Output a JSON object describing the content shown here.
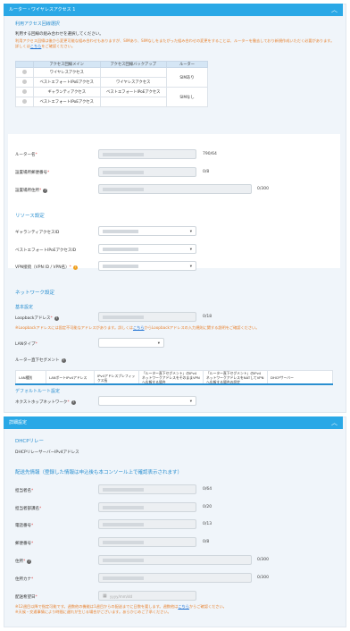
{
  "router_section": {
    "header": "ルーター・ワイヤレスアクセス 1",
    "plan": {
      "title": "利用アクセス回線選択",
      "instruction": "利用する回線の組み合わせを選択してください。",
      "note_before": "利用アクセス回線は後から変更可能な組み合わせもありますが、SIMあり、SIMなしをまたがった組み合わせの変更をすることは、ルーターを撤去しており新規作成いただく必要があります。詳しくは",
      "note_link": "こちら",
      "note_after": "をご確認ください。",
      "columns": [
        "アクセス回線メイン",
        "アクセス回線バックアップ",
        "ルーター"
      ],
      "rows": [
        {
          "main": "ワイヤレスアクセス",
          "backup": ""
        },
        {
          "main": "ベストエフォートIPoEアクセス",
          "backup": "ワイヤレスアクセス"
        },
        {
          "main": "ギャランティアクセス",
          "backup": "ベストエフォートIPoEアクセス"
        },
        {
          "main": "ベストエフォートIPoEアクセス",
          "backup": ""
        }
      ],
      "router_groups": [
        "SIMあり",
        "SIMなし"
      ]
    },
    "fields": {
      "router_name": {
        "label": "ルーター名",
        "count": "790/64"
      },
      "postal_code": {
        "label": "設置場所郵便番号",
        "count": "0/8"
      },
      "address": {
        "label": "設置場所住所",
        "count": "0/300"
      }
    },
    "resources": {
      "title": "リソース設定",
      "guarantee_id": "ギャランティアクセスID",
      "besteffort_id": "ベストエフォートIPoEアクセスID",
      "vpn": "VPN接続（VPN ID / VPN名）"
    },
    "network": {
      "title": "ネットワーク設定",
      "basic": "基本設定",
      "loopback_label": "Loopbackアドレス",
      "loopback_count": "0/18",
      "loopback_note_before": "※Loopbackアドレスには固定不可能なアドレスがあります。詳しくは",
      "loopback_note_link": "こちら",
      "loopback_note_after": "からLoopbackアドレスの入力規則に関する説明をご確認ください。",
      "lan_type": "LANタイプ",
      "lan_segment": "ルーター直下セグメント",
      "segment_columns": [
        "LAN種別",
        "LANポートIPv4アドレス",
        "IPv4アドレスプレフィックス長",
        "「ルーター直下セグメント」のIPv4ネットワークアドレスをそのままVPNへ広報する場合",
        "「ルーター直下セグメント」のIPv4ネットワークアドレスをNATしてVPNへ広報する場合の設定",
        "DHCPサーバー"
      ],
      "default_route": "デフォルトルート設定",
      "next_hop": "ネクストホップネットワーク"
    }
  },
  "detail_section": {
    "header": "詳細設定",
    "dhcp_title": "DHCPリレー",
    "dhcp_item": "DHCPリレーサーバーIPv4アドレス",
    "shipping_title": "配送先情報（登録した情報は申込後も本コンソール上で確認表示されます）",
    "fields": {
      "person": {
        "label": "担当者名",
        "count": "0/64"
      },
      "department": {
        "label": "担当者部課名",
        "count": "0/20"
      },
      "phone": {
        "label": "電話番号",
        "count": "0/13"
      },
      "postal": {
        "label": "郵便番号",
        "count": "0/8"
      },
      "address": {
        "label": "住所",
        "count": "0/300"
      },
      "address_kana": {
        "label": "住所カナ",
        "count": "0/300"
      },
      "date": {
        "label": "配送希望日",
        "placeholder": "yyyy/mm/dd"
      }
    },
    "delivery_note_1a": "※12週目以降で指定可能です。週数他の機能は1週目からの配送までに日数を要します。週数他は",
    "delivery_note_link": "こちら",
    "delivery_note_1b": "からご確認ください。",
    "delivery_note_2": "※天候・交通事情により時間に遅れが生じる場合がございます。あらかじめご了承ください。"
  }
}
